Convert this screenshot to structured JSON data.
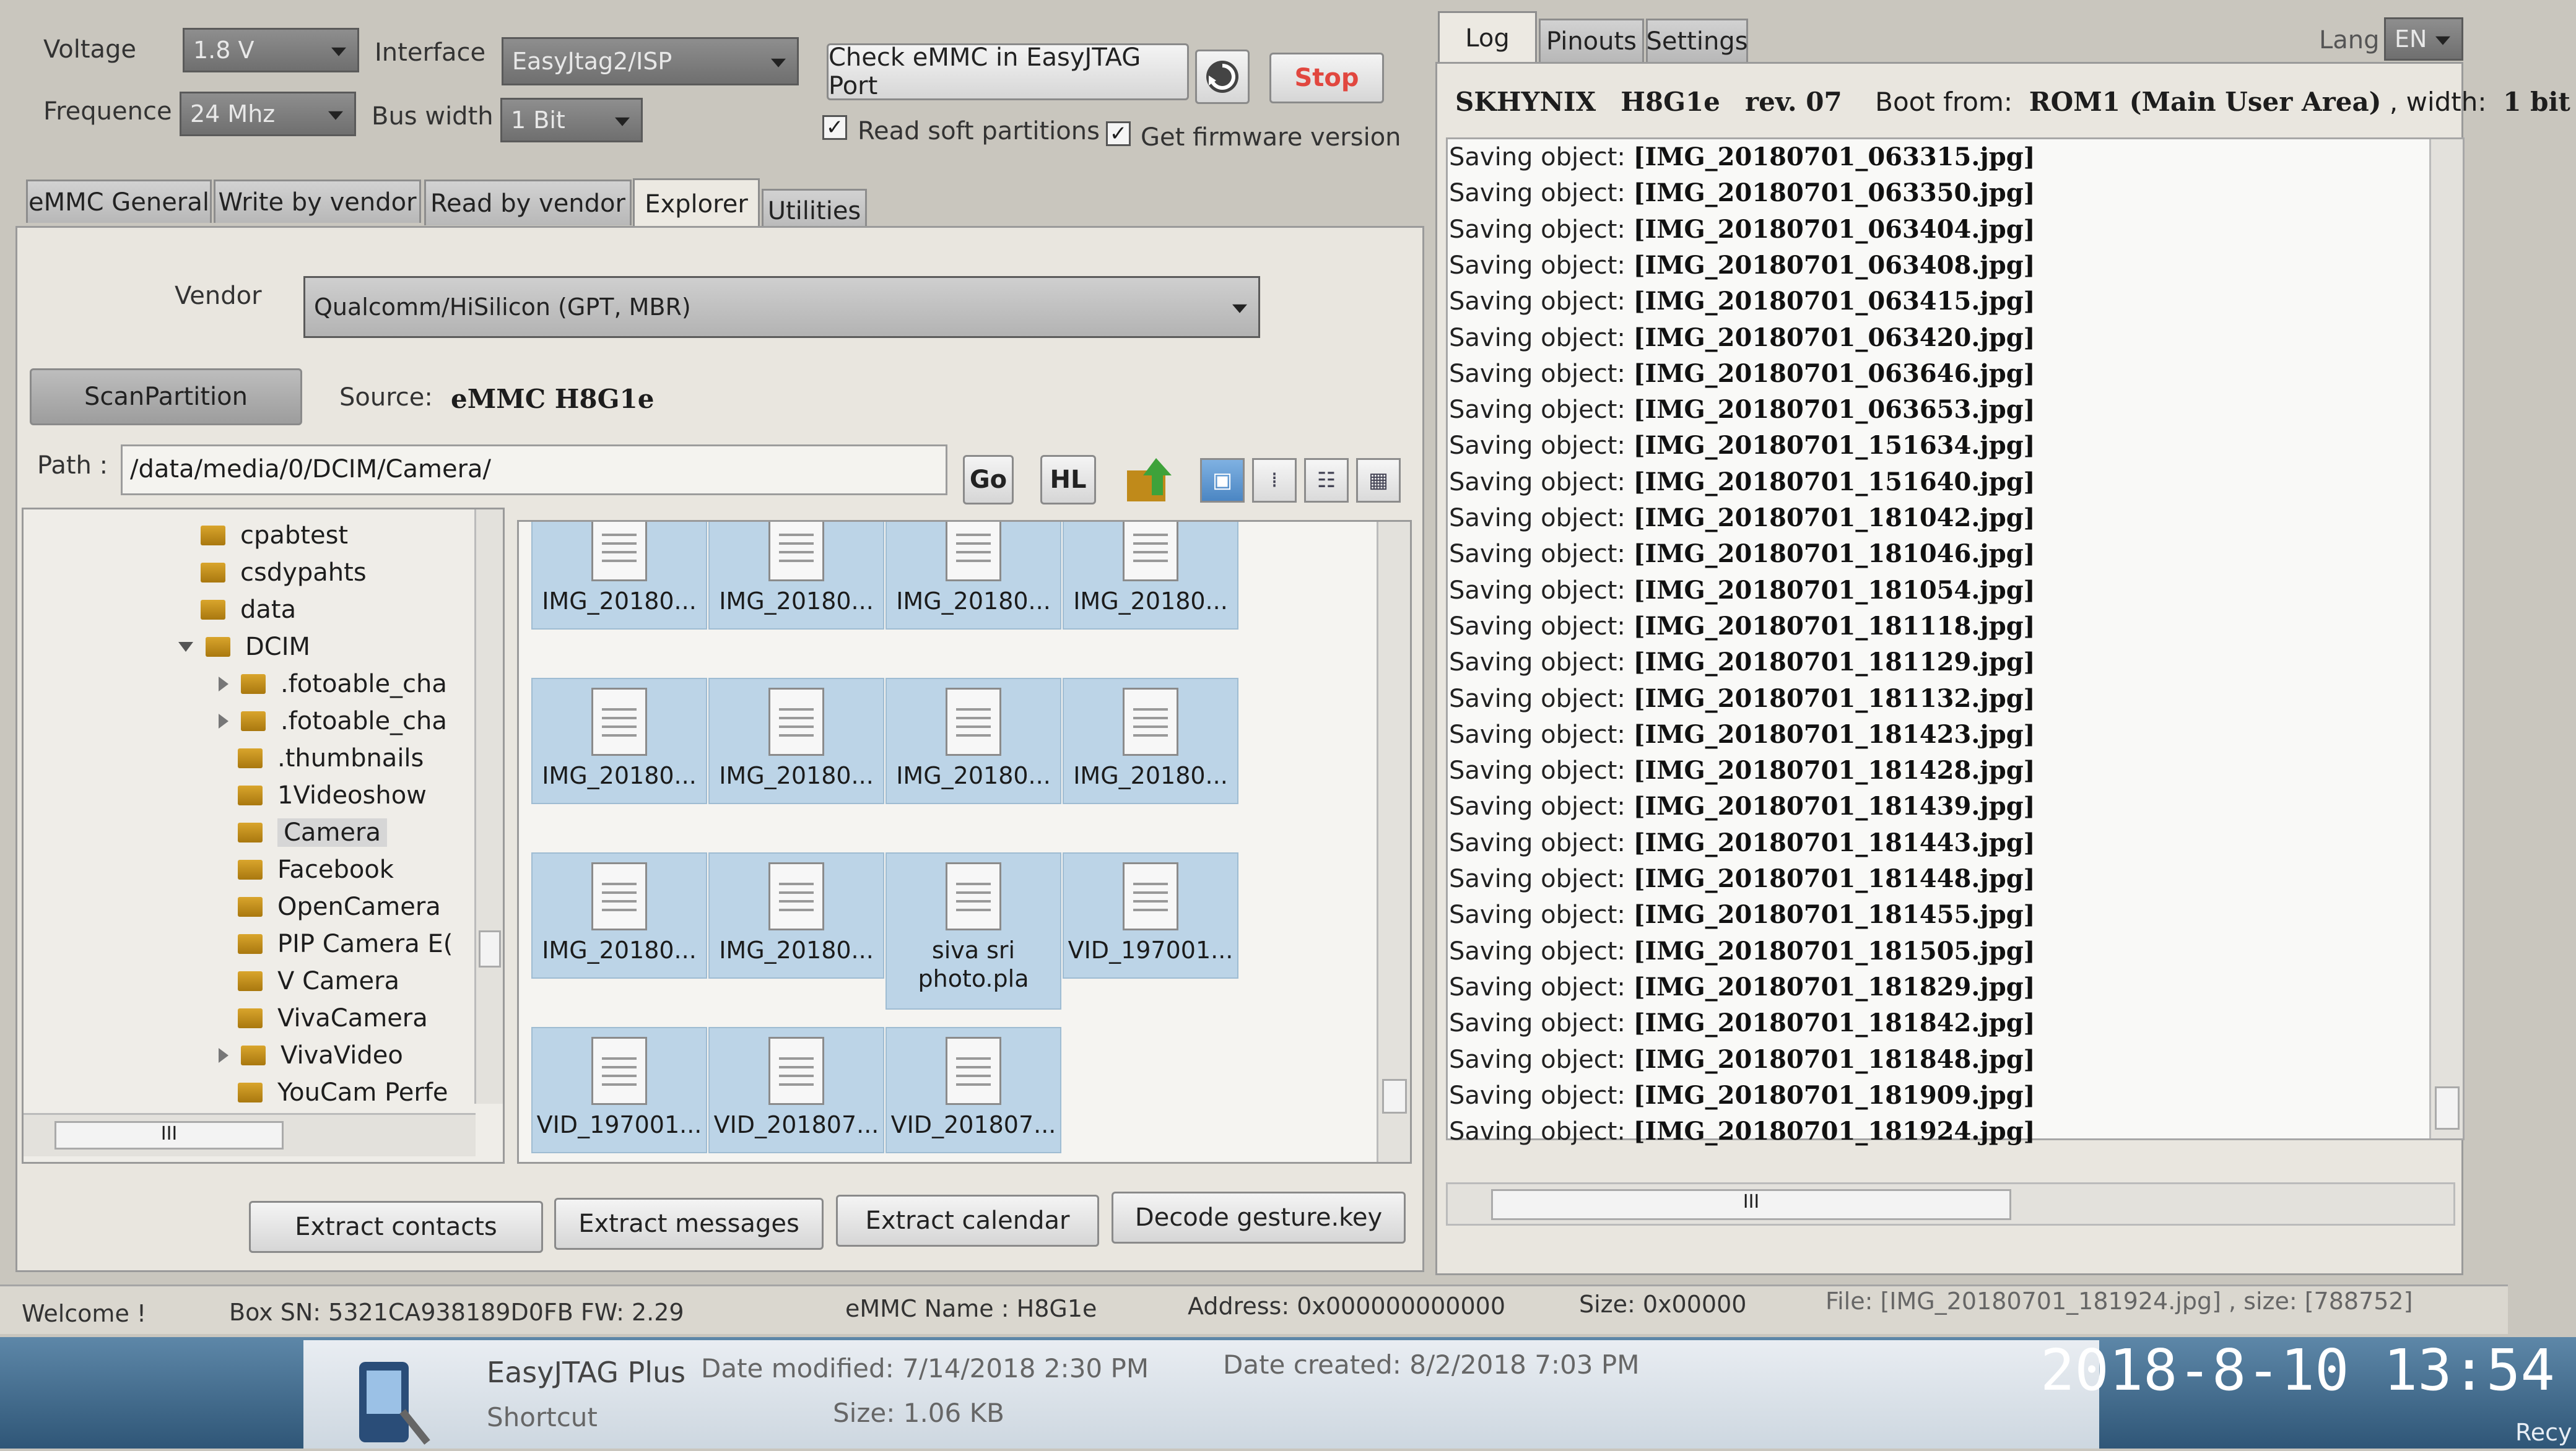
{
  "top": {
    "voltage_label": "Voltage",
    "voltage_value": "1.8 V",
    "frequence_label": "Frequence",
    "frequence_value": "24 Mhz",
    "interface_label": "Interface",
    "interface_value": "EasyJtag2/ISP",
    "buswidth_label": "Bus width",
    "buswidth_value": "1 Bit",
    "check_button": "Check eMMC in EasyJTAG Port",
    "stop_button": "Stop",
    "read_soft_label": "Read soft partitions",
    "get_firmware_label": "Get firmware version",
    "check_mark": "✓"
  },
  "tabs": [
    "eMMC General",
    "Write by vendor",
    "Read by vendor",
    "Explorer",
    "Utilities"
  ],
  "explorer": {
    "vendor_label": "Vendor",
    "vendor_value": "Qualcomm/HiSilicon (GPT, MBR)",
    "scan_button": "ScanPartition",
    "source_label": "Source:",
    "source_value": "eMMC H8G1e",
    "path_label": "Path :",
    "path_value": "/data/media/0/DCIM/Camera/",
    "go_button": "Go",
    "hl_button": "HL"
  },
  "tree": [
    {
      "label": "cpabtest",
      "indent": 1,
      "exp": ""
    },
    {
      "label": "csdypahts",
      "indent": 1,
      "exp": ""
    },
    {
      "label": "data",
      "indent": 1,
      "exp": ""
    },
    {
      "label": "DCIM",
      "indent": 1,
      "exp": "open"
    },
    {
      "label": ".fotoable_cha",
      "indent": 2,
      "exp": "closed"
    },
    {
      "label": ".fotoable_cha",
      "indent": 2,
      "exp": "closed"
    },
    {
      "label": ".thumbnails",
      "indent": 2,
      "exp": ""
    },
    {
      "label": "1Videoshow",
      "indent": 2,
      "exp": ""
    },
    {
      "label": "Camera",
      "indent": 2,
      "exp": "",
      "selected": true
    },
    {
      "label": "Facebook",
      "indent": 2,
      "exp": ""
    },
    {
      "label": "OpenCamera",
      "indent": 2,
      "exp": ""
    },
    {
      "label": "PIP Camera E(",
      "indent": 2,
      "exp": ""
    },
    {
      "label": "V Camera",
      "indent": 2,
      "exp": ""
    },
    {
      "label": "VivaCamera",
      "indent": 2,
      "exp": ""
    },
    {
      "label": "VivaVideo",
      "indent": 2,
      "exp": "closed"
    },
    {
      "label": "YouCam Perfe",
      "indent": 2,
      "exp": ""
    }
  ],
  "tree_hscroll_label": "III",
  "files": [
    "IMG_20180...",
    "IMG_20180...",
    "IMG_20180...",
    "IMG_20180...",
    "IMG_20180...",
    "IMG_20180...",
    "IMG_20180...",
    "IMG_20180...",
    "IMG_20180...",
    "IMG_20180...",
    "siva sri photo.pla",
    "VID_197001...",
    "VID_197001...",
    "VID_201807...",
    "VID_201807..."
  ],
  "bottom_buttons": [
    "Extract contacts",
    "Extract messages",
    "Extract calendar",
    "Decode gesture.key"
  ],
  "right": {
    "tabs": [
      "Log",
      "Pinouts",
      "Settings"
    ],
    "lang_label": "Lang",
    "lang_value": "EN",
    "header": {
      "chip_vendor": "SKHYNIX",
      "chip_name": "H8G1e",
      "chip_rev": "rev. 07",
      "boot_text": "Boot from:",
      "boot_value": "ROM1 (Main User Area)",
      "width_text": ", width:",
      "width_value": "1 bit"
    },
    "log_prefix": "Saving object:",
    "log": [
      "[IMG_20180701_063315.jpg]",
      "[IMG_20180701_063350.jpg]",
      "[IMG_20180701_063404.jpg]",
      "[IMG_20180701_063408.jpg]",
      "[IMG_20180701_063415.jpg]",
      "[IMG_20180701_063420.jpg]",
      "[IMG_20180701_063646.jpg]",
      "[IMG_20180701_063653.jpg]",
      "[IMG_20180701_151634.jpg]",
      "[IMG_20180701_151640.jpg]",
      "[IMG_20180701_181042.jpg]",
      "[IMG_20180701_181046.jpg]",
      "[IMG_20180701_181054.jpg]",
      "[IMG_20180701_181118.jpg]",
      "[IMG_20180701_181129.jpg]",
      "[IMG_20180701_181132.jpg]",
      "[IMG_20180701_181423.jpg]",
      "[IMG_20180701_181428.jpg]",
      "[IMG_20180701_181439.jpg]",
      "[IMG_20180701_181443.jpg]",
      "[IMG_20180701_181448.jpg]",
      "[IMG_20180701_181455.jpg]",
      "[IMG_20180701_181505.jpg]",
      "[IMG_20180701_181829.jpg]",
      "[IMG_20180701_181842.jpg]",
      "[IMG_20180701_181848.jpg]",
      "[IMG_20180701_181909.jpg]",
      "[IMG_20180701_181924.jpg]"
    ],
    "hscroll_label": "III"
  },
  "status": {
    "welcome": "Welcome !",
    "box_sn": "Box SN:  5321CA938189D0FB  FW:  2.29",
    "emmc_name": "eMMC Name : H8G1e",
    "address": "Address: 0x000000000000",
    "size": "Size: 0x00000",
    "file": "File:  [IMG_20180701_181924.jpg] , size: [788752]"
  },
  "taskbar": {
    "app_name": "EasyJTAG Plus",
    "date_modified": "Date modified: 7/14/2018 2:30 PM",
    "date_created": "Date created: 8/2/2018 7:03 PM",
    "type": "Shortcut",
    "size": "Size: 1.06 KB",
    "timestamp": "2018-8-10  13:54",
    "recycle": "Recy"
  },
  "colors": {
    "accent_blue": "#4b86c3",
    "stop_red": "#e1473f",
    "tile_blue": "#bcd4e7",
    "folder_gold": "#c08a1a"
  }
}
